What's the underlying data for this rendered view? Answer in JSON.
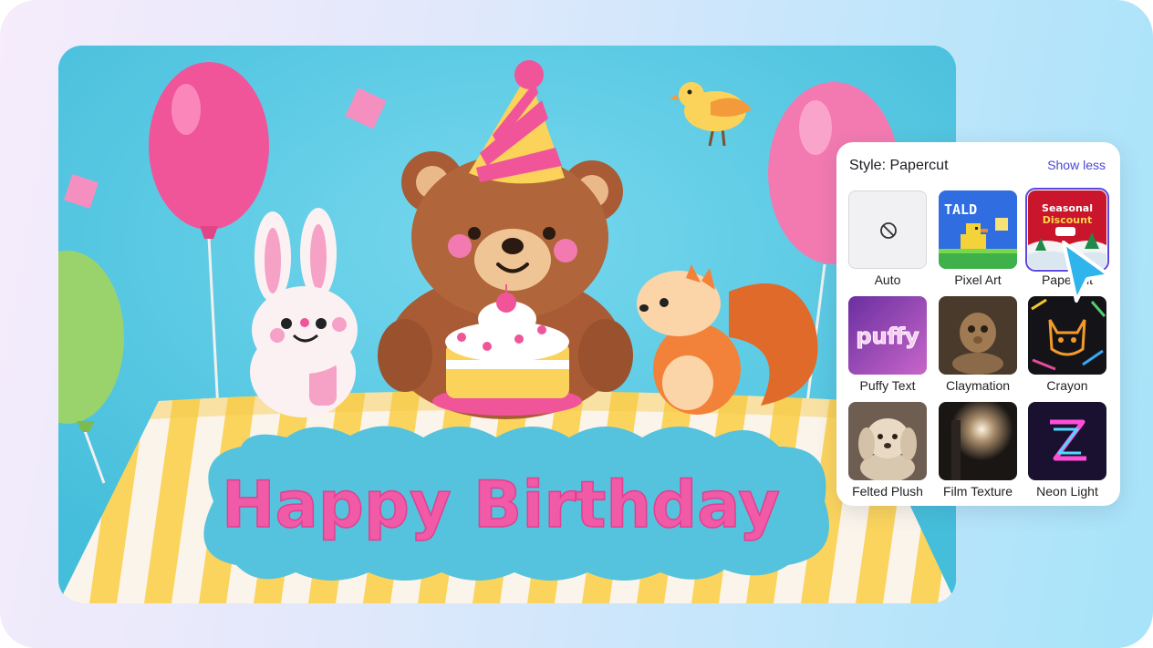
{
  "scene": {
    "banner_text": "Happy Birthday"
  },
  "style_panel": {
    "title_prefix": "Style:",
    "current_style": "Papercut",
    "toggle_label": "Show less",
    "styles": [
      {
        "label": "Auto",
        "icon": "no-style-icon"
      },
      {
        "label": "Pixel Art",
        "thumb_text": "TALD"
      },
      {
        "label": "Papercut",
        "thumb_text_1": "Seasonal",
        "thumb_text_2": "Discount",
        "selected": true
      },
      {
        "label": "Puffy Text",
        "thumb_text": "puffy"
      },
      {
        "label": "Claymation"
      },
      {
        "label": "Crayon"
      },
      {
        "label": "Felted Plush"
      },
      {
        "label": "Film Texture"
      },
      {
        "label": "Neon Light"
      }
    ]
  },
  "colors": {
    "accent": "#4a46d6",
    "selection": "#5b45e0",
    "cursor": "#2fb4ec"
  }
}
